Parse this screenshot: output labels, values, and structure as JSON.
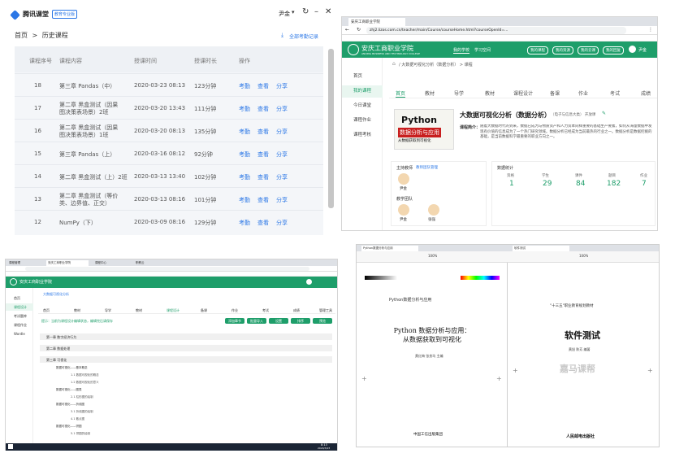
{
  "q1": {
    "app_name": "腾讯课堂",
    "app_badge": "教育专业版",
    "user": "尹金",
    "breadcrumb_home": "首页",
    "breadcrumb_sep": ">",
    "breadcrumb_current": "历史课程",
    "download_all": "全部考勤记录",
    "headers": [
      "课程序号",
      "课程内容",
      "授课时间",
      "授课时长",
      "操作"
    ],
    "rows": [
      {
        "no": "18",
        "name": "第三章 Pandas（中）",
        "time": "2020-03-23 08:13",
        "dur": "123分钟"
      },
      {
        "no": "17",
        "name": "第二章 黑盒测试（因果图决策表场景）2班",
        "time": "2020-03-20 13:43",
        "dur": "111分钟"
      },
      {
        "no": "16",
        "name": "第二章 黑盒测试（因果图决策表场景）1班",
        "time": "2020-03-20 08:13",
        "dur": "135分钟"
      },
      {
        "no": "15",
        "name": "第三章 Pandas（上）",
        "time": "2020-03-16 08:12",
        "dur": "92分钟"
      },
      {
        "no": "14",
        "name": "第二章 黑盒测试（上）2班",
        "time": "2020-03-13 13:40",
        "dur": "102分钟"
      },
      {
        "no": "13",
        "name": "第二章 黑盒测试（等价类、边界值、正交）",
        "time": "2020-03-13 08:16",
        "dur": "101分钟"
      },
      {
        "no": "12",
        "name": "NumPy（下）",
        "time": "2020-03-09 08:16",
        "dur": "129分钟"
      }
    ],
    "ops": [
      "考勤",
      "查看",
      "分享"
    ]
  },
  "q2": {
    "tab_title": "安庆工商职业学院",
    "url": "zhj2.lizos.com.cn/teacher/main/Course/courseHome.html?courseOpenId=...",
    "school": "安庆工商职业学院",
    "school_en": "ANQING BUSINESS AND TECHNOLOGY COLLEGE",
    "nav": [
      "我的学校",
      "学习空间"
    ],
    "top_btns": [
      "我的课程",
      "我的资源",
      "我的云课",
      "我的回复"
    ],
    "user": "尹金",
    "side": [
      "首页",
      "我的课程",
      "今日课堂",
      "课程作业",
      "课程考核"
    ],
    "crumb": "/ 大数据可视化分析（数据分析） > 课程",
    "tabs": [
      "首页",
      "教材",
      "导学",
      "教材",
      "课程设计",
      "备课",
      "作业",
      "考试",
      "成绩"
    ],
    "course_title": "大数据可视化分析（数据分析）",
    "course_meta": "（电子与信息大类）  开放课",
    "book_title": "Python",
    "book_sub": "数据分析与应用",
    "book_sub2": "从数据获取到可视化",
    "desc_label": "课程简介：",
    "desc": "随着大数据时代的到来，数据已成为与物质资产和人力资本同样重要的基础生产要素，如何从海量数据中发现有价值的信息成为了一个热门研究领域。数据分析已经成为当前最热的行业之一。数据分析是数据挖掘的基础，是当前数据科学最重要的职业方向之一。",
    "team_label": "主持教师",
    "team_link": "教师团队管理",
    "teacher": "尹金",
    "member_label": "教学团队",
    "members": [
      "尹金",
      "张强"
    ],
    "stats_label": "数据统计",
    "stats": [
      {
        "k": "资格",
        "v": "1"
      },
      {
        "k": "学生",
        "v": "29"
      },
      {
        "k": "课件",
        "v": "84"
      },
      {
        "k": "题目",
        "v": "182"
      },
      {
        "k": "作业",
        "v": "7"
      }
    ]
  },
  "q3": {
    "tabs": [
      "课程管理",
      "安庆工商职业学院",
      "课程中心",
      "职教云"
    ],
    "nav": [
      "首页",
      "教材",
      "导学",
      "教材",
      "课程设计",
      "备课",
      "作业",
      "考试",
      "成绩",
      "管理工具"
    ],
    "side": [
      "首页",
      "课程设计",
      "考试题库",
      "课程作业",
      "Wordle"
    ],
    "crumb": "大数据可视化分析",
    "notice": "提示：当前为课程设计编辑状态，编辑完后请保存",
    "btns": [
      "添加章节",
      "批量导入",
      "设置",
      "排序",
      "预览"
    ],
    "chapters": [
      "第一章 数字经济行为",
      "第二章 数据处理",
      "第三章 可视化"
    ],
    "items": [
      "数据可视化——基本概念",
      "1.1 数据可视化的概念",
      "1.2 数据可视化的意义",
      "数据可视化——图表",
      "2.1 柱形图的绘制",
      "数据可视化——折线图",
      "3.1 折线图的绘制",
      "4.1 散点图",
      "数据可视化——饼图",
      "5.1 饼图的绘制"
    ],
    "task_time": "8:13",
    "task_date": "2020/3/23"
  },
  "q4": {
    "tab_left": "Python数据分析与应用",
    "tab_right": "软件测试",
    "left_header": "Python数据分析与应用",
    "left_title": "Python 数据分析与应用：\n从数据获取到可视化",
    "left_author": "黄红梅 张良均  主编",
    "left_publisher": "中国工信出版集团",
    "right_header": "\"十三五\"职业教育规划教材",
    "right_title": "软件测试",
    "right_author": "黄旭 陈芳 编著",
    "right_publisher": "人民邮电出版社",
    "watermark": "嘉马课帮",
    "zoom": "100%"
  },
  "colors": {
    "green": "#1e9e6a",
    "blue_link": "#2b77e6"
  }
}
